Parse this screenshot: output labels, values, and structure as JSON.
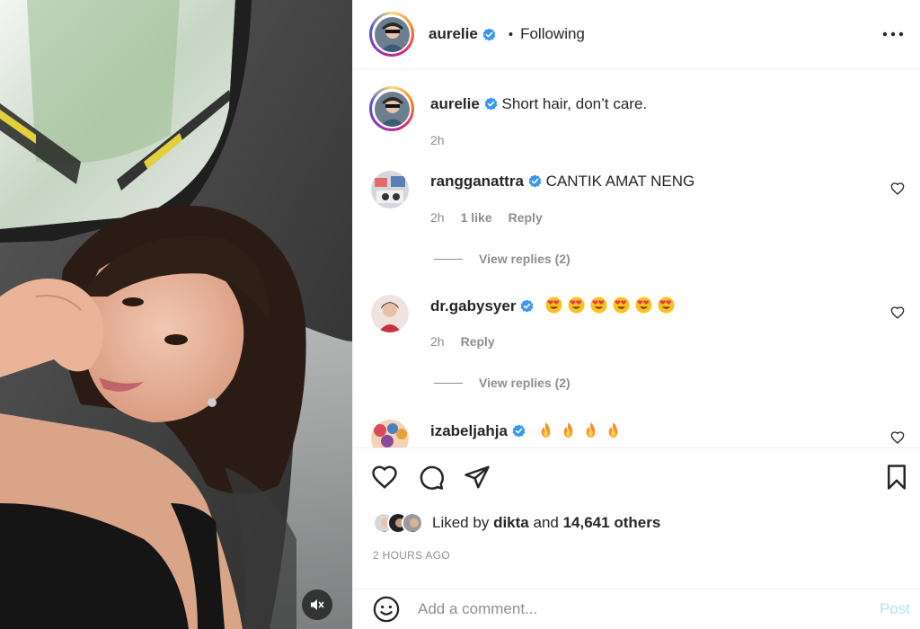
{
  "post": {
    "author": "aurelie",
    "follow_status": "Following",
    "separator": "•",
    "caption": "Short hair, don’t care.",
    "caption_time": "2h"
  },
  "comments": [
    {
      "username": "rangganattra",
      "text": "CANTIK AMAT NENG",
      "time": "2h",
      "likes": "1 like",
      "reply_label": "Reply",
      "view_replies": "View replies (2)",
      "avatar_color": "#c8c8c8"
    },
    {
      "username": "dr.gabysyer",
      "emoji_icons": [
        "heart-eyes-emoji",
        "heart-eyes-emoji",
        "heart-eyes-emoji",
        "heart-eyes-emoji",
        "heart-eyes-emoji",
        "heart-eyes-emoji"
      ],
      "time": "2h",
      "reply_label": "Reply",
      "view_replies": "View replies (2)",
      "avatar_color": "#e8d6cf"
    },
    {
      "username": "izabeljahja",
      "emoji_icons": [
        "fire-emoji",
        "fire-emoji",
        "fire-emoji",
        "fire-emoji"
      ],
      "avatar_color": "#d65a5a"
    }
  ],
  "likes": {
    "prefix": "Liked by",
    "user": "dikta",
    "conjunction": "and",
    "others": "14,641 others"
  },
  "posted_ago": "2 HOURS AGO",
  "comment_box": {
    "placeholder": "Add a comment...",
    "post_label": "Post"
  },
  "colors": {
    "verified": "#3897f0",
    "secondary_text": "#8e8e8e",
    "post_disabled": "#b2dffc"
  }
}
